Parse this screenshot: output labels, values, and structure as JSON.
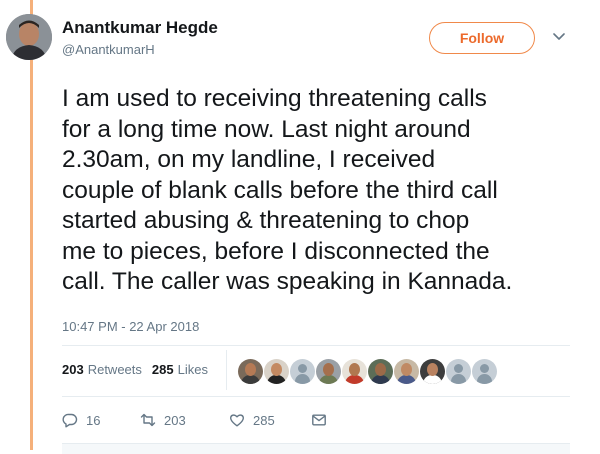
{
  "author": {
    "name": "Anantkumar Hegde",
    "handle": "@AnantkumarH",
    "avatar_icon": "profile-photo"
  },
  "follow_button": {
    "label": "Follow",
    "accent": "#ec6a2c"
  },
  "more_menu_icon": "chevron-down-icon",
  "tweet": {
    "text": "I am used to receiving threatening calls\nfor a long time now. Last night around\n2.30am, on my landline,  I received\ncouple of blank calls before the third call\nstarted abusing & threatening to chop\nme to pieces, before I disconnected the\ncall. The caller was speaking in Kannada.",
    "timestamp": "10:47 PM - 22 Apr 2018"
  },
  "stats": {
    "retweets_count": "203",
    "retweets_label": "Retweets",
    "likes_count": "285",
    "likes_label": "Likes"
  },
  "likers": [
    {
      "kind": "photo",
      "skin": "#b57a55",
      "shirt": "#3b3b3b",
      "bg": "#7a6a5a"
    },
    {
      "kind": "photo",
      "skin": "#c48a62",
      "shirt": "#222222",
      "bg": "#d9d2c8"
    },
    {
      "kind": "default"
    },
    {
      "kind": "photo",
      "skin": "#a56f4d",
      "shirt": "#6d7a54",
      "bg": "#9aa0a6"
    },
    {
      "kind": "photo",
      "skin": "#b07850",
      "shirt": "#c23b2a",
      "bg": "#e7e2d9"
    },
    {
      "kind": "photo",
      "skin": "#9c6a48",
      "shirt": "#2f3a4f",
      "bg": "#5c6d57"
    },
    {
      "kind": "photo",
      "skin": "#c08a64",
      "shirt": "#4a5a8a",
      "bg": "#c7b9a5"
    },
    {
      "kind": "photo",
      "skin": "#b98260",
      "shirt": "#ffffff",
      "bg": "#3d3d3d"
    },
    {
      "kind": "default"
    },
    {
      "kind": "default"
    }
  ],
  "actions": {
    "replies": "16",
    "retweets": "203",
    "likes": "285"
  }
}
